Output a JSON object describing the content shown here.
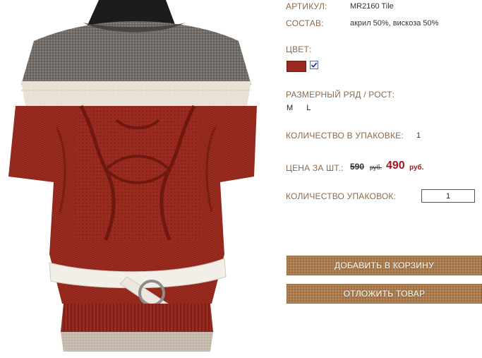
{
  "product": {
    "article_label": "АРТИКУЛ:",
    "article_value": "MR2160 Tile",
    "composition_label": "СОСТАВ:",
    "composition_value": "акрил 50%, вискоза 50%",
    "color_label": "ЦВЕТ:",
    "color_swatch": "#9a2a1f",
    "color_checkbox_icon": "checkmark-icon",
    "size_label": "РАЗМЕРНЫЙ РЯД / РОСТ:",
    "sizes": [
      "M",
      "L"
    ],
    "pack_qty_label": "КОЛИЧЕСТВО В УПАКОВКЕ:",
    "pack_qty_value": "1",
    "price_label": "ЦЕНА ЗА ШТ.:",
    "price_old": "590",
    "price_old_unit": "руб.",
    "price_new": "490",
    "price_new_unit": "руб.",
    "packages_label": "КОЛИЧЕСТВО УПАКОВОК:",
    "packages_value": "1"
  },
  "actions": {
    "add_to_cart": "ДОБАВИТЬ В КОРЗИНУ",
    "reserve": "ОТЛОЖИТЬ ТОВАР"
  },
  "colors": {
    "label_text": "#8b6a4c",
    "price_new": "#a3141e",
    "button_bg": "#a8794a",
    "sweater_red": "#9a2a1f",
    "sweater_grey": "#6f6a66",
    "sweater_cream": "#e8e2d6"
  }
}
